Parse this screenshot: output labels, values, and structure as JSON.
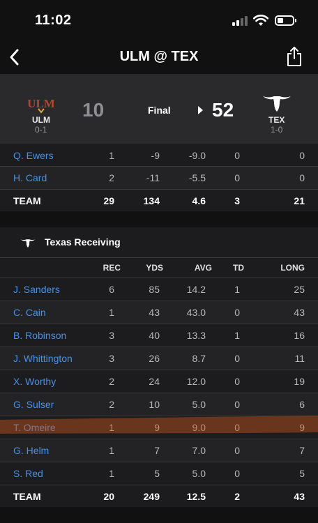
{
  "status_bar": {
    "time": "11:02"
  },
  "nav": {
    "title": "ULM @ TEX"
  },
  "game": {
    "away": {
      "abbr": "ULM",
      "record": "0-1",
      "score": "10",
      "logo_text": "ULM"
    },
    "home": {
      "abbr": "TEX",
      "record": "1-0",
      "score": "52"
    },
    "status": "Final"
  },
  "rushing_partial": {
    "rows": [
      [
        "Q. Ewers",
        "1",
        "-9",
        "-9.0",
        "0",
        "0"
      ],
      [
        "H. Card",
        "2",
        "-11",
        "-5.5",
        "0",
        "0"
      ]
    ],
    "team": [
      "TEAM",
      "29",
      "134",
      "4.6",
      "3",
      "21"
    ]
  },
  "receiving": {
    "title": "Texas Receiving",
    "headers": [
      "REC",
      "YDS",
      "AVG",
      "TD",
      "LONG"
    ],
    "rows": [
      [
        "J. Sanders",
        "6",
        "85",
        "14.2",
        "1",
        "25"
      ],
      [
        "C. Cain",
        "1",
        "43",
        "43.0",
        "0",
        "43"
      ],
      [
        "B. Robinson",
        "3",
        "40",
        "13.3",
        "1",
        "16"
      ],
      [
        "J. Whittington",
        "3",
        "26",
        "8.7",
        "0",
        "11"
      ],
      [
        "X. Worthy",
        "2",
        "24",
        "12.0",
        "0",
        "19"
      ],
      [
        "G. Sulser",
        "2",
        "10",
        "5.0",
        "0",
        "6"
      ],
      [
        "T. Omeire",
        "1",
        "9",
        "9.0",
        "0",
        "9"
      ],
      [
        "G. Helm",
        "1",
        "7",
        "7.0",
        "0",
        "7"
      ],
      [
        "S. Red",
        "1",
        "5",
        "5.0",
        "0",
        "5"
      ]
    ],
    "team": [
      "TEAM",
      "20",
      "249",
      "12.5",
      "2",
      "43"
    ]
  },
  "colors": {
    "player_link": "#4a90e2",
    "ulm_maroon": "#b5452e",
    "highlight": "#c8541a"
  }
}
